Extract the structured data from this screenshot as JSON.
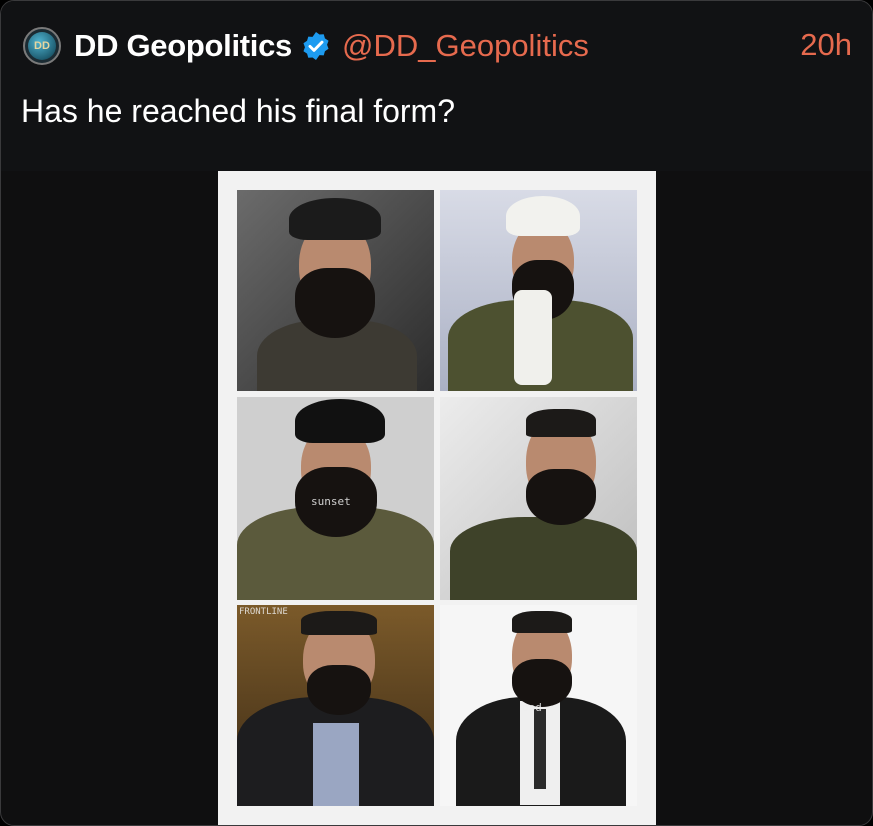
{
  "post": {
    "author": {
      "name": "DD Geopolitics",
      "handle": "@DD_Geopolitics",
      "avatar_text": "DD",
      "verified_icon": "verified-badge-icon"
    },
    "time": "20h",
    "text": "Has he reached his final form?"
  },
  "media": {
    "watermarks": [
      "sunset",
      "FRONTLINE",
      "ood"
    ]
  },
  "colors": {
    "accent": "#e66a4e",
    "verified": "#1d9bf0",
    "background": "#0f0f10"
  }
}
